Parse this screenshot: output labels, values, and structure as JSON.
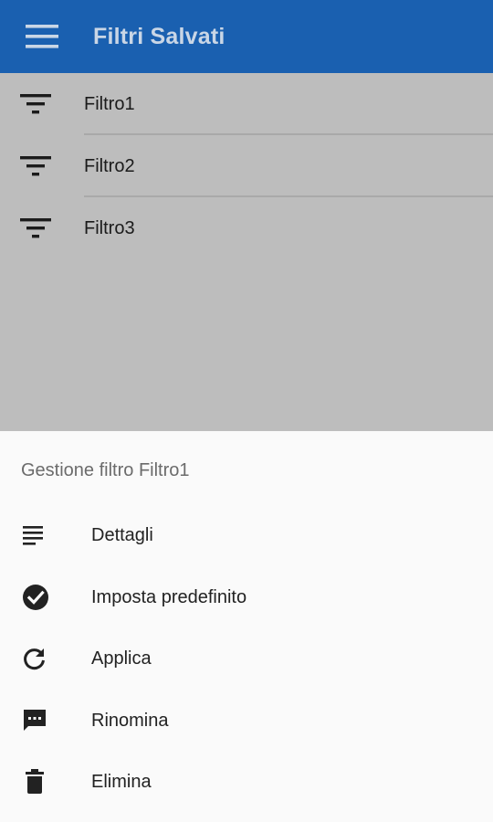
{
  "appbar": {
    "title": "Filtri Salvati",
    "menu_icon": "menu-icon",
    "background": "#1a60b0"
  },
  "filters": [
    {
      "label": "Filtro1",
      "icon": "filter-list-icon"
    },
    {
      "label": "Filtro2",
      "icon": "filter-list-icon"
    },
    {
      "label": "Filtro3",
      "icon": "filter-list-icon"
    }
  ],
  "sheet": {
    "title": "Gestione filtro Filtro1",
    "items": [
      {
        "label": "Dettagli",
        "icon": "subject-icon"
      },
      {
        "label": "Imposta predefinito",
        "icon": "check-circle-icon"
      },
      {
        "label": "Applica",
        "icon": "refresh-icon"
      },
      {
        "label": "Rinomina",
        "icon": "comment-icon"
      },
      {
        "label": "Elimina",
        "icon": "trash-icon"
      }
    ]
  }
}
